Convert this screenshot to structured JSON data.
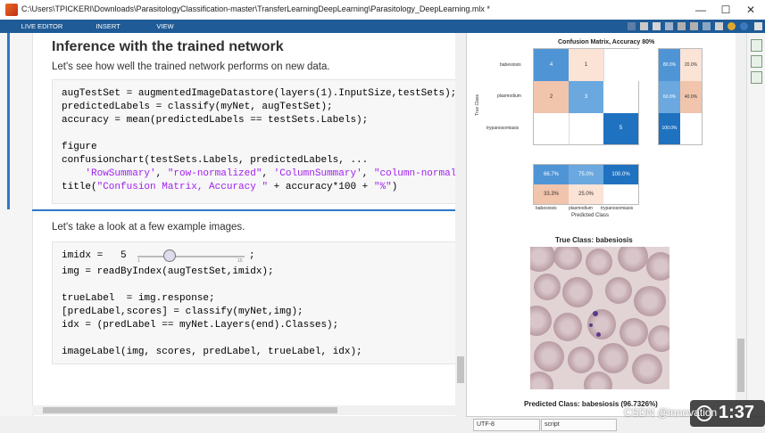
{
  "window": {
    "title": "C:\\Users\\TPICKERI\\Downloads\\ParasitologyClassification-master\\TransferLearningDeepLearning\\Parasitology_DeepLearning.mlx *",
    "minimize": "—",
    "maximize": "☐",
    "close": "✕"
  },
  "tabs": [
    "LIVE EDITOR",
    "INSERT",
    "VIEW"
  ],
  "editor": {
    "heading": "Inference with the trained network",
    "intro": "Let's see how well the trained network performs on new data.",
    "code1": {
      "l1": "augTestSet = augmentedImageDatastore(layers(1).InputSize,testSets); %",
      "l2": "predictedLabels = classify(myNet, augTestSet);",
      "l3": "accuracy = mean(predictedLabels == testSets.Labels);",
      "l4": "figure",
      "l5": "confusionchart(testSets.Labels, predictedLabels, ...",
      "l6a": "    ",
      "l6s1": "'RowSummary'",
      "l6b": ", ",
      "l6s2": "\"row-normalized\"",
      "l6c": ", ",
      "l6s3": "'ColumnSummary'",
      "l6d": ", ",
      "l6s4": "\"column-normaliz",
      "l7a": "title(",
      "l7s1": "\"Confusion Matrix, Accuracy \"",
      "l7b": " + accuracy*100 + ",
      "l7s2": "\"%\"",
      "l7c": ")"
    },
    "section2_text": "Let's take a look at a few example images.",
    "code2": {
      "l1a": "imidx =   5",
      "l1b": ";",
      "slider_min": "1",
      "slider_max": "15",
      "l2": "img = readByIndex(augTestSet,imidx);",
      "l3": "trueLabel  = img.response;",
      "l4": "[predLabel,scores] = classify(myNet,img);",
      "l5": "idx = (predLabel == myNet.Layers(end).Classes);",
      "l6": "imageLabel(img, scores, predLabel, trueLabel, idx);"
    }
  },
  "output": {
    "cm_title": "Confusion Matrix, Accuracy 80%",
    "rows": [
      "babesiosis",
      "plasmodium",
      "trypanosomiasis"
    ],
    "cells": [
      [
        "4",
        "1",
        ""
      ],
      [
        "2",
        "3",
        ""
      ],
      [
        "",
        "",
        "5"
      ]
    ],
    "row_summary": [
      [
        "80.0%",
        "20.0%"
      ],
      [
        "60.0%",
        "40.0%"
      ],
      [
        "100.0%",
        ""
      ]
    ],
    "col_summary": [
      [
        "66.7%",
        "75.0%",
        "100.0%"
      ],
      [
        "33.3%",
        "25.0%",
        ""
      ]
    ],
    "ylabel": "True Class",
    "xlabel": "Predicted Class",
    "true_class": "True Class: babesiosis",
    "predicted_class": "Predicted Class: babesiosis (96.7326%)"
  },
  "statusbar": {
    "encoding": "UTF-8",
    "mode": "script"
  },
  "overlay": {
    "watermark": "CSDN @innovation",
    "time": "1:37"
  },
  "colors": {
    "tabbar": "#1f5b96",
    "accent": "#2e78c6",
    "cm_dark": "#1f72c0",
    "cm_mid": "#4f95d6",
    "cm_light_blue": "#a9cbeb",
    "cm_salmon": "#f1c4ac"
  }
}
